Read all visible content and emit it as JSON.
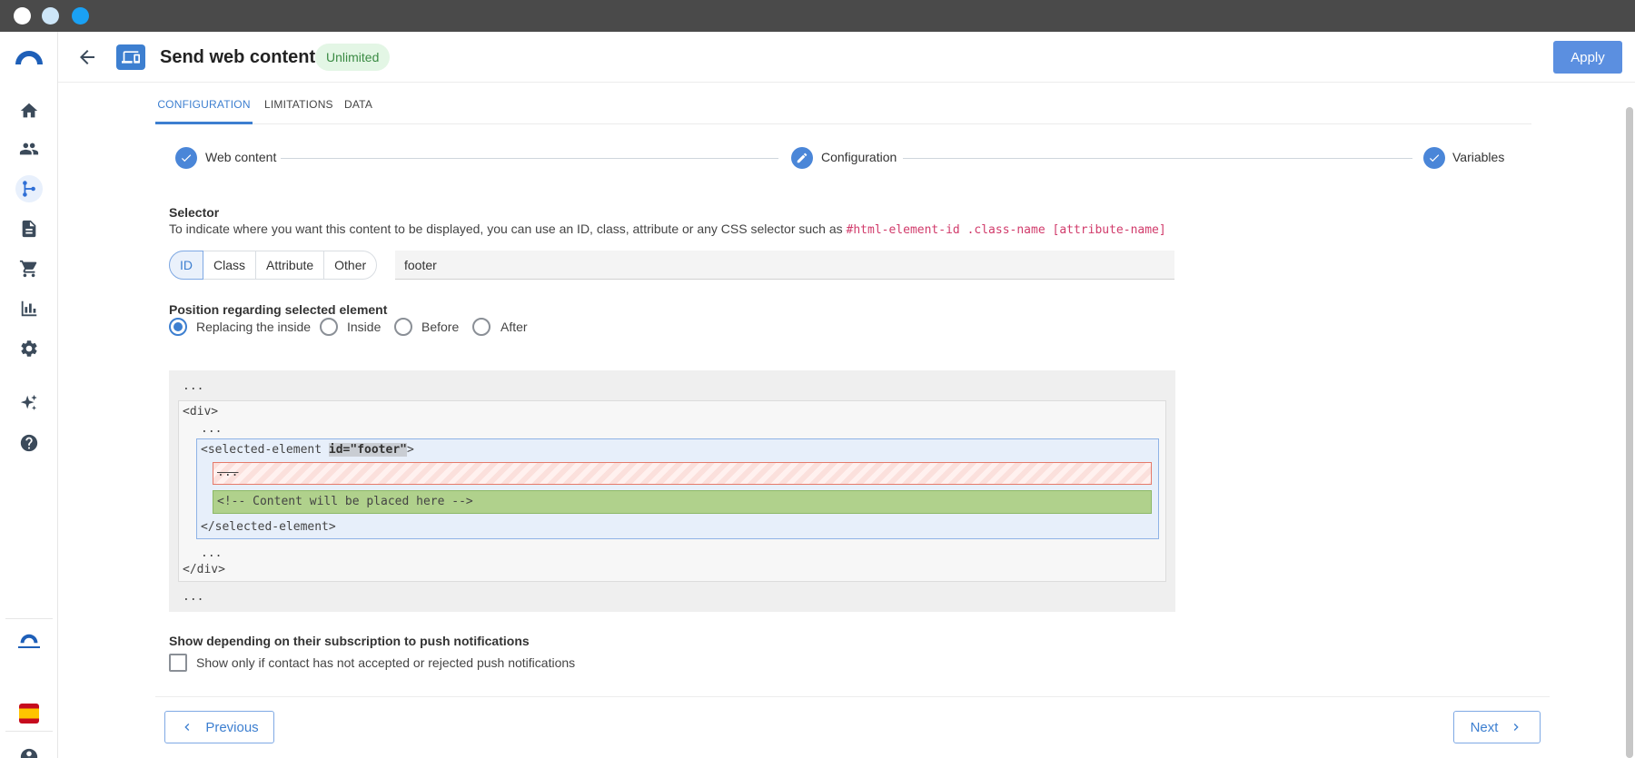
{
  "header": {
    "title": "Send web content",
    "badge": "Unlimited",
    "apply_label": "Apply"
  },
  "tabs": [
    "CONFIGURATION",
    "LIMITATIONS",
    "DATA"
  ],
  "stepper": [
    "Web content",
    "Configuration",
    "Variables"
  ],
  "selector": {
    "title": "Selector",
    "description": "To indicate where you want this content to be displayed, you can use an ID, class, attribute or any CSS selector such as ",
    "example_code": "#html-element-id .class-name [attribute-name]",
    "types": [
      "ID",
      "Class",
      "Attribute",
      "Other"
    ],
    "selected_type": "ID",
    "input_value": "footer"
  },
  "position": {
    "title": "Position regarding selected element",
    "options": [
      "Replacing the inside",
      "Inside",
      "Before",
      "After"
    ],
    "selected": "Replacing the inside"
  },
  "preview": {
    "dots": "...",
    "div_open": "<div>",
    "div_close": "</div>",
    "selected_open_prefix": "<selected-element ",
    "selected_attr": "id=\"footer\"",
    "selected_open_suffix": ">",
    "removed_content": "...",
    "placeholder_comment": "<!-- Content will be placed here -->",
    "selected_close": "</selected-element>"
  },
  "push": {
    "title": "Show depending on their subscription to push notifications",
    "checkbox_label": "Show only if contact has not accepted or rejected push notifications",
    "checked": false
  },
  "footer": {
    "previous_label": "Previous",
    "next_label": "Next"
  },
  "icons": {
    "sidebar": [
      "logo-icon",
      "home-icon",
      "contacts-icon",
      "workflow-icon",
      "document-icon",
      "cart-icon",
      "chart-icon",
      "settings-icon",
      "sparkle-icon",
      "help-icon"
    ],
    "accent": "#3d7fd0"
  }
}
